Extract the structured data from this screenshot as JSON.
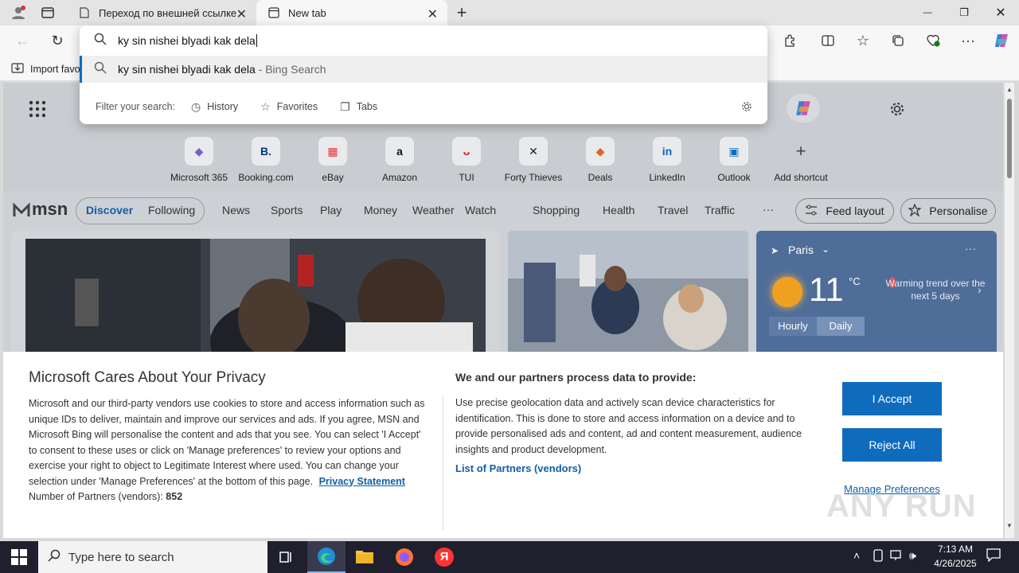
{
  "tabs": [
    {
      "title": "Переход по внешней ссылке",
      "close": "✕"
    },
    {
      "title": "New tab",
      "close": "✕"
    }
  ],
  "new_tab_button": "+",
  "window_controls": {
    "minimize": "—",
    "maximize": "❐",
    "close": "✕"
  },
  "omnibox": {
    "input_value": "ky sin nishei blyadi kak dela",
    "suggestion_text": "ky sin nishei blyadi kak dela",
    "suggestion_source": " - Bing Search",
    "filter_label": "Filter your search:",
    "filters": [
      "History",
      "Favorites",
      "Tabs"
    ]
  },
  "favorites_bar": {
    "import_label": "Import favo"
  },
  "shortcuts": [
    {
      "label": "Microsoft 365",
      "glyph": "◆",
      "color": "#7b5cd6"
    },
    {
      "label": "Booking.com",
      "glyph": "B.",
      "color": "#003580"
    },
    {
      "label": "eBay",
      "glyph": "▦",
      "color": "#e53238"
    },
    {
      "label": "Amazon",
      "glyph": "a",
      "color": "#111111"
    },
    {
      "label": "TUI",
      "glyph": "ᴗ",
      "color": "#d40e14"
    },
    {
      "label": "Forty Thieves",
      "glyph": "✕",
      "color": "#222222"
    },
    {
      "label": "Deals",
      "glyph": "◆",
      "color": "#e8622b"
    },
    {
      "label": "LinkedIn",
      "glyph": "in",
      "color": "#0a66c2"
    },
    {
      "label": "Outlook",
      "glyph": "▣",
      "color": "#0f6cbd"
    },
    {
      "label": "Add shortcut",
      "glyph": "+",
      "color": "#444444"
    }
  ],
  "msn": {
    "logo": "msn",
    "tabs": [
      "Discover",
      "Following"
    ],
    "nav": [
      "News",
      "Sports",
      "Play",
      "Money",
      "Weather",
      "Watch",
      "Shopping",
      "Health",
      "Travel",
      "Traffic"
    ],
    "more": "···",
    "feed_layout": "Feed layout",
    "personalise": "Personalise"
  },
  "weather": {
    "city": "Paris",
    "temp": "11",
    "unit": "°C",
    "trend": "Warming trend over the next 5 days",
    "toggle": [
      "Hourly",
      "Daily"
    ]
  },
  "privacy": {
    "title": "Microsoft Cares About Your Privacy",
    "body": "Microsoft and our third-party vendors use cookies to store and access information such as unique IDs to deliver, maintain and improve our services and ads. If you agree, MSN and Microsoft Bing will personalise the content and ads that you see. You can select 'I Accept' to consent to these uses or click on 'Manage preferences' to review your options and exercise your right to object to Legitimate Interest where used. You can change your selection under 'Manage Preferences' at the bottom of this page.",
    "privacy_link": "Privacy Statement",
    "partners_label": "Number of Partners (vendors):",
    "partners_count": "852",
    "right_title": "We and our partners process data to provide:",
    "right_body": "Use precise geolocation data and actively scan device characteristics for identification. This is done to store and access information on a device and to provide personalised ads and content, ad and content measurement, audience insights and product development.",
    "partners_link": "List of Partners (vendors)",
    "accept": "I Accept",
    "reject": "Reject All",
    "manage": "Manage Preferences"
  },
  "taskbar": {
    "search_placeholder": "Type here to search",
    "time": "7:13 AM",
    "date": "4/26/2025"
  },
  "watermark": "ANY RUN"
}
